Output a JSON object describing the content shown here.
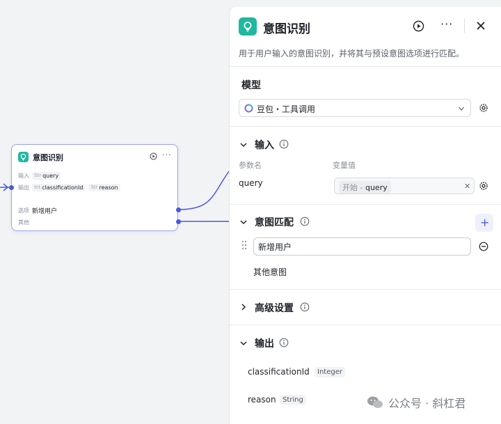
{
  "node": {
    "title": "意图识别",
    "input_label": "输入",
    "input_type": "Str",
    "input_value": "query",
    "output_label": "输出",
    "out1_type": "Int",
    "out1_value": "classificationId",
    "out2_type": "Str",
    "out2_value": "reason",
    "option_label": "选项",
    "option_value": "新增用户",
    "other_label": "其他"
  },
  "panel": {
    "title": "意图识别",
    "description": "用于用户输入的意图识别，并将其与预设意图选项进行匹配。",
    "model": {
      "section_title": "模型",
      "selected": "豆包・工具调用"
    },
    "input": {
      "section_title": "输入",
      "col_param": "参数名",
      "col_value": "变量值",
      "param_name": "query",
      "ref_source": "开始 -",
      "ref_var": "query"
    },
    "intent": {
      "section_title": "意图匹配",
      "items": [
        "新增用户"
      ],
      "other": "其他意图"
    },
    "advanced": {
      "section_title": "高级设置"
    },
    "output": {
      "section_title": "输出",
      "fields": [
        {
          "name": "classificationId",
          "type": "Integer"
        },
        {
          "name": "reason",
          "type": "String"
        }
      ]
    }
  },
  "watermark": "公众号 · 斜杠君",
  "colors": {
    "accent": "#4e59d8",
    "node_icon": "#1fb8a0",
    "canvas": "#f2f3f5"
  },
  "icons": [
    "bulb-icon",
    "run-icon",
    "more-icon",
    "close-icon",
    "chevron-down-icon",
    "chevron-right-icon",
    "info-icon",
    "gear-icon",
    "plus-icon",
    "minus-icon",
    "drag-handle-icon",
    "wechat-icon"
  ]
}
